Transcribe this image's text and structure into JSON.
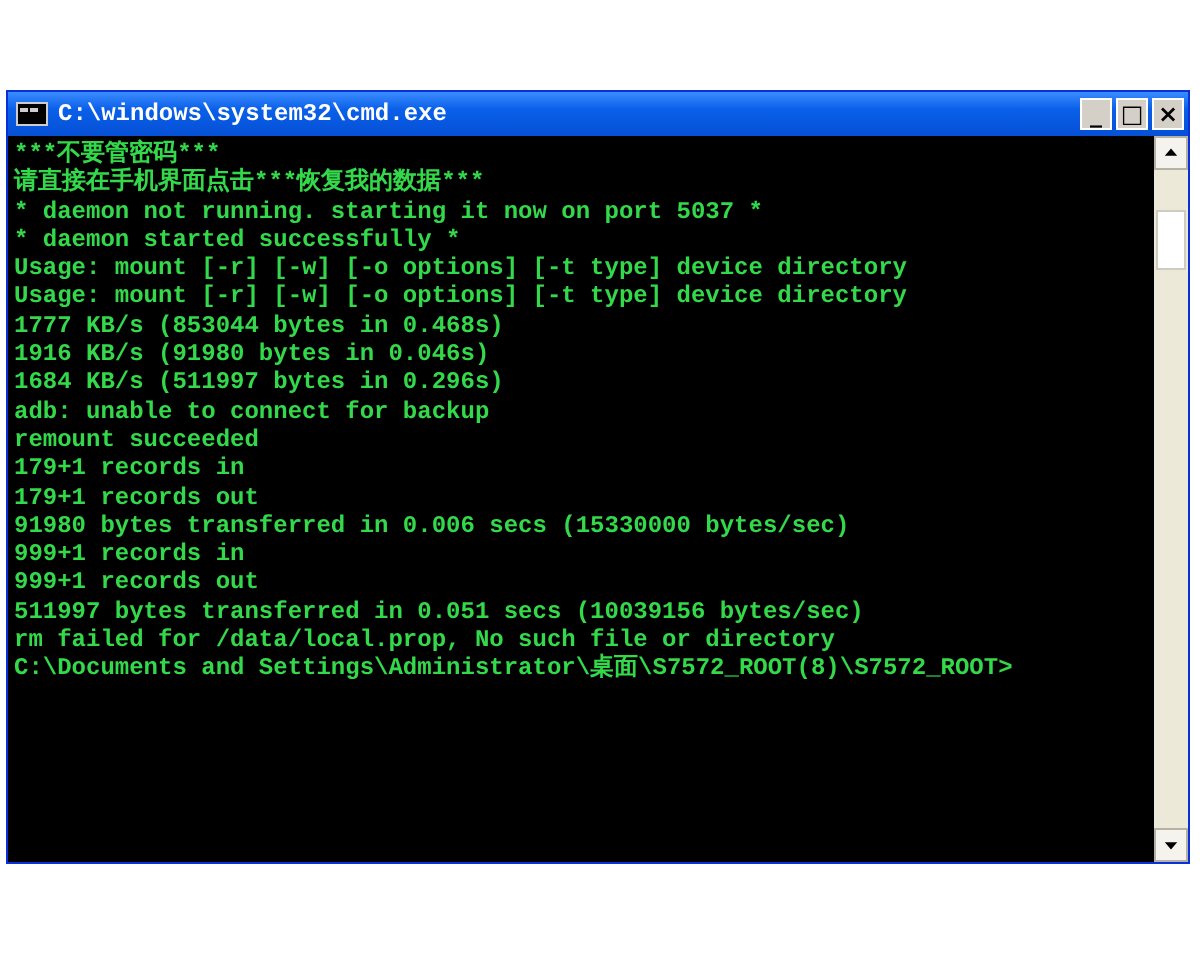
{
  "window": {
    "title": "C:\\windows\\system32\\cmd.exe",
    "buttons": [
      "_",
      "□",
      "×"
    ]
  },
  "console": {
    "lines": [
      "***不要管密码***",
      "请直接在手机界面点击***恢复我的数据***",
      "* daemon not running. starting it now on port 5037 *",
      "* daemon started successfully *",
      "Usage: mount [-r] [-w] [-o options] [-t type] device directory",
      "Usage: mount [-r] [-w] [-o options] [-t type] device directory",
      "1777 KB/s (853044 bytes in 0.468s)",
      "1916 KB/s (91980 bytes in 0.046s)",
      "1684 KB/s (511997 bytes in 0.296s)",
      "adb: unable to connect for backup",
      "remount succeeded",
      "179+1 records in",
      "179+1 records out",
      "91980 bytes transferred in 0.006 secs (15330000 bytes/sec)",
      "999+1 records in",
      "999+1 records out",
      "511997 bytes transferred in 0.051 secs (10039156 bytes/sec)",
      "rm failed for /data/local.prop, No such file or directory",
      "C:\\Documents and Settings\\Administrator\\桌面\\S7572_ROOT(8)\\S7572_ROOT>"
    ]
  }
}
